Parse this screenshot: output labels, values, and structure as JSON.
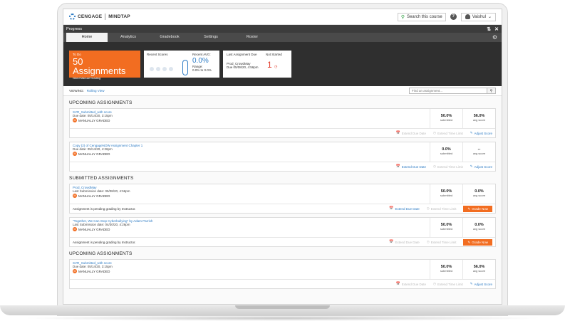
{
  "header": {
    "logo_left": "CENGAGE",
    "logo_right": "MINDTAP",
    "search_label": "Search this course",
    "help_glyph": "?",
    "user_name": "Vaishul"
  },
  "app": {
    "title": "Progress",
    "tabs": [
      "Home",
      "Analytics",
      "Gradebook",
      "Settings",
      "Roster"
    ]
  },
  "dashboard": {
    "todo_label": "To Do",
    "todo_value": "50 Assignments",
    "todo_sub": "Need Manual Grading",
    "recent_scores_label": "Recent Scores",
    "recent_avg_label": "Recent AVG:",
    "recent_avg_value": "0.0%",
    "range_label": "Range:",
    "range_value": "0.0% to 0.0%",
    "last_due_label": "Last Assignment Due",
    "last_due_name": "Prod_CrowdMay",
    "last_due_date": "Due 05/08/20, 4:56pm",
    "not_started_label": "Not Started",
    "not_started_value": "1"
  },
  "viewing": {
    "label": "VIEWING:",
    "value": "Rolling View",
    "find_placeholder": "Find an assignment..."
  },
  "labels": {
    "manually_graded": "MANUALLY GRADED",
    "submitted": "submitted",
    "avg_score": "avg score",
    "extend_due": "Extend Due Date",
    "extend_time": "Extend Time Limit",
    "adjust_score": "Adjust Score",
    "grade_now": "Grade Now",
    "pending": "Assignment is pending grading by Instructor."
  },
  "sections": {
    "upcoming": "UPCOMING ASSIGNMENTS",
    "submitted": "SUBMITTED ASSIGNMENTS",
    "upcoming2": "UPCOMING ASSIGNMENTS"
  },
  "assignments": {
    "a1": {
      "title": "SVR_Submitted_with score",
      "date": "Due date: 05/14/20, 3:15pm",
      "submitted": "50.0%",
      "avg": "56.0%"
    },
    "a2": {
      "title": "Copy (2) of CengageNOW Assignment Chapter 1",
      "date": "Due date: 05/14/20, 4:26pm",
      "submitted": "0.0%",
      "avg": "--"
    },
    "a3": {
      "title": "Prod_CrowdMay",
      "date": "Last Submission date: 05/08/20, 4:56pm",
      "submitted": "50.0%",
      "avg": "0.0%"
    },
    "a4": {
      "title": "\"Together, We Can Stop Cyberbullying\" by Adam Parrish",
      "date": "Last Submission date: 04/30/20, 4:26pm",
      "submitted": "50.0%",
      "avg": "0.0%"
    },
    "a5": {
      "title": "SVR_Submitted_with score",
      "date": "Due date: 05/14/20, 3:15pm",
      "submitted": "50.0%",
      "avg": "56.0%"
    }
  },
  "colors": {
    "accent_orange": "#f26d21",
    "link_blue": "#2d7bc4",
    "alert_red": "#e23b2b"
  },
  "icons": [
    "search-icon",
    "help-icon",
    "user-icon",
    "settings-gear-icon",
    "close-icon",
    "expand-icon",
    "calendar-icon",
    "clock-icon",
    "pencil-icon"
  ]
}
